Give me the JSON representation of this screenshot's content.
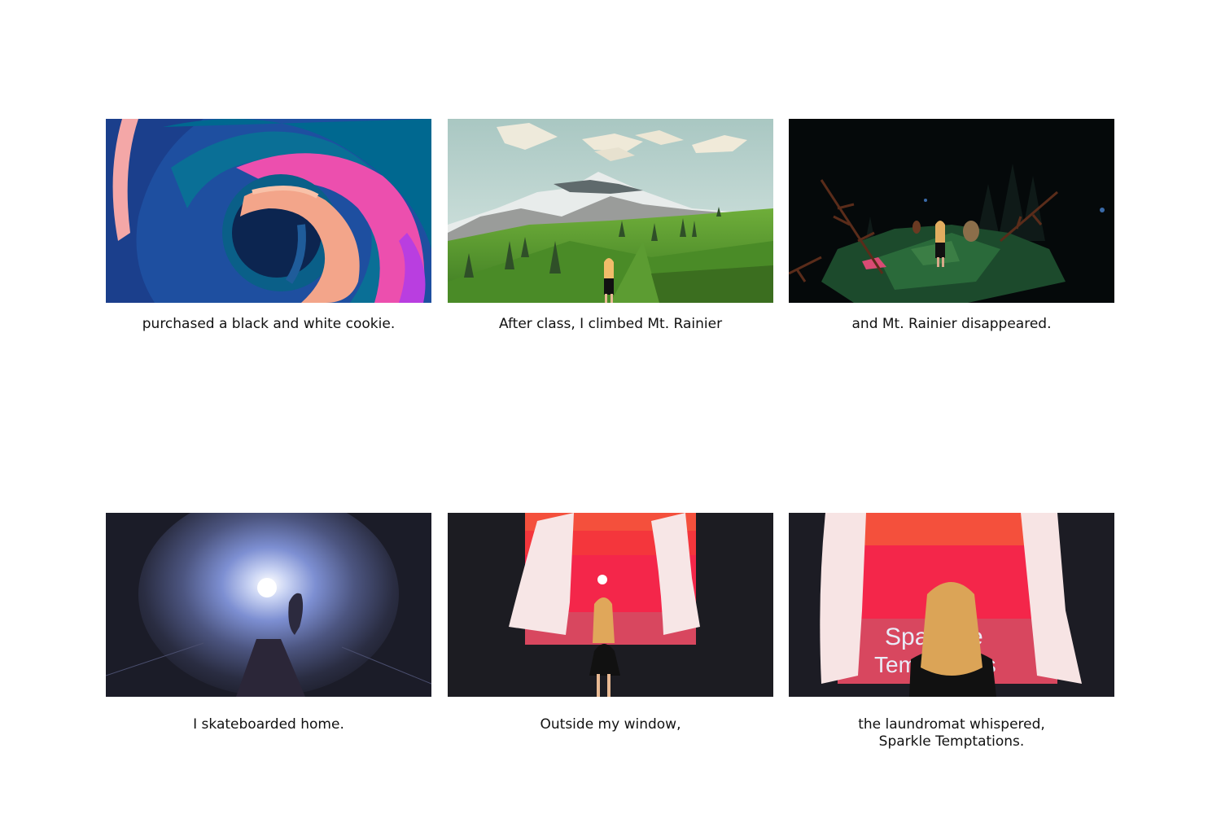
{
  "panels": [
    {
      "caption": [
        "purchased a black and white cookie."
      ],
      "scene": "swirl-painting"
    },
    {
      "caption": [
        "After class, I climbed Mt. Rainier"
      ],
      "scene": "mountain-meadow"
    },
    {
      "caption": [
        "and Mt. Rainier disappeared."
      ],
      "scene": "dark-forest"
    },
    {
      "caption": [
        "I skateboarded home."
      ],
      "scene": "moon-tunnel"
    },
    {
      "caption": [
        "Outside my window,"
      ],
      "scene": "red-sunset-window"
    },
    {
      "caption": [
        "the laundromat whispered,",
        "Sparkle Temptations."
      ],
      "scene": "laundromat-sign-window"
    }
  ],
  "sign_text": [
    "Spa",
    "e",
    "Tem",
    "ns"
  ],
  "colors": {
    "background": "#ffffff",
    "caption_text": "#111111",
    "dark_frame": "#1c1c22",
    "sunset_red": "#f4264a",
    "sunset_orange": "#f4503c",
    "meadow_green": "#4f8f2a",
    "swirl_blue": "#1e4fa0",
    "swirl_pink": "#ec4fae"
  }
}
